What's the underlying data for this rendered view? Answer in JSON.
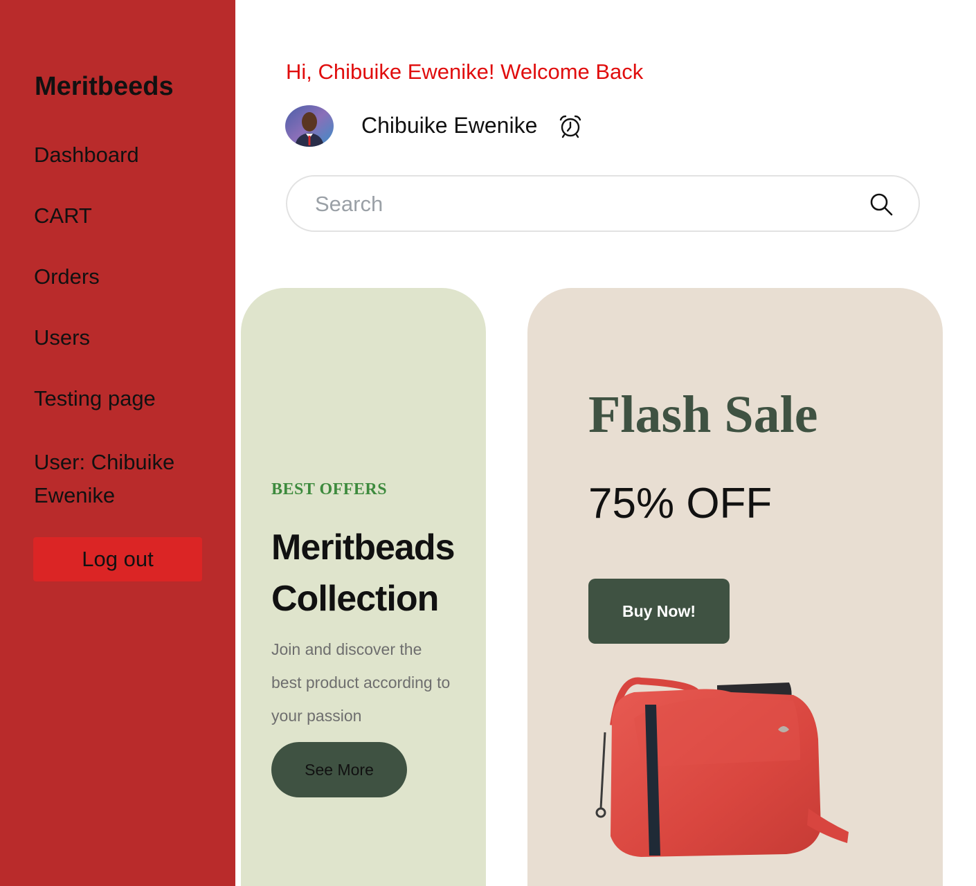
{
  "sidebar": {
    "brand": "Meritbeeds",
    "items": [
      {
        "label": "Dashboard"
      },
      {
        "label": "CART"
      },
      {
        "label": "Orders"
      },
      {
        "label": "Users"
      },
      {
        "label": "Testing page"
      }
    ],
    "user_label": "User: Chibuike Ewenike",
    "logout_label": "Log out",
    "background_color": "#b92b2b",
    "logout_color": "#db2525"
  },
  "header": {
    "greeting": "Hi, Chibuike Ewenike! Welcome Back",
    "greeting_color": "#e00d0d",
    "username": "Chibuike Ewenike",
    "alarm_icon": "alarm-clock-icon"
  },
  "search": {
    "placeholder": "Search",
    "value": "",
    "icon": "search-icon"
  },
  "promo_left": {
    "tag": "BEST OFFERS",
    "title": "Meritbeads Collection",
    "description": "Join and discover the best product according to your passion",
    "button_label": "See More",
    "background_color": "#dfe4cc",
    "tag_color": "#3d8a3d",
    "button_color": "#3f5242"
  },
  "promo_right": {
    "title": "Flash Sale",
    "discount": "75% OFF",
    "button_label": "Buy Now!",
    "background_color": "#e8ded2",
    "title_color": "#3f5242",
    "button_color": "#3f5242",
    "product_icon": "red-handbag-image"
  }
}
